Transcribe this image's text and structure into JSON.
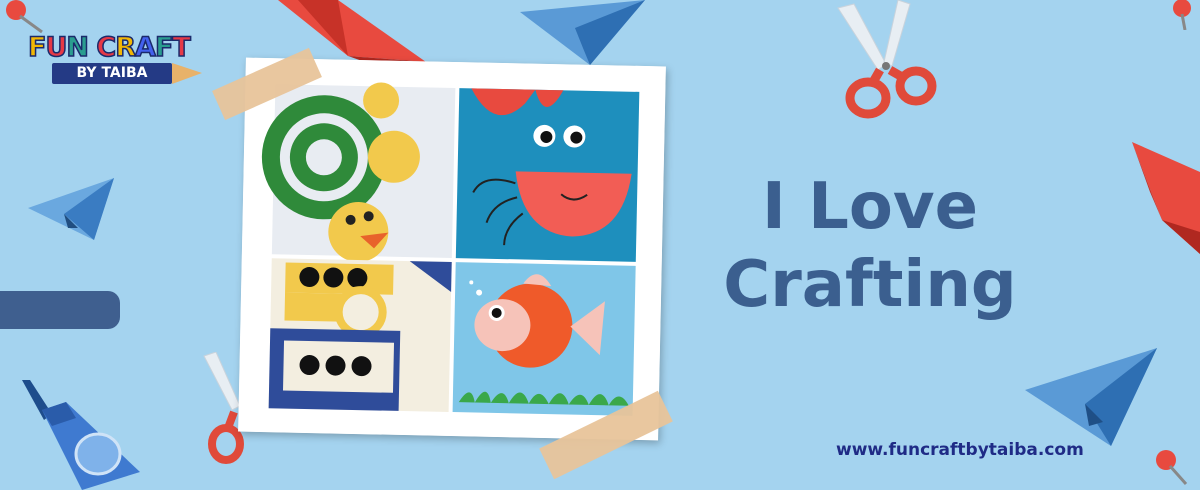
{
  "logo": {
    "line1": [
      "F",
      "U",
      "N",
      " ",
      "C",
      "R",
      "A",
      "F",
      "T"
    ],
    "line1_colors": [
      "#f2b705",
      "#e63946",
      "#2a9d8f",
      "#ffffff",
      "#e63946",
      "#f2b705",
      "#4361ee",
      "#2a9d8f",
      "#e63946"
    ],
    "line2": "BY TAIBA"
  },
  "headline": {
    "line1": "I Love",
    "line2": "Crafting"
  },
  "website": "www.funcraftbytaiba.com",
  "colors": {
    "background": "#a4d3ef",
    "headline": "#3b5f8f",
    "url": "#1f2b86",
    "accent_red": "#e84a3f",
    "accent_blue": "#4a86c8"
  },
  "icons": [
    "paper-plane-icon",
    "origami-boat-icon",
    "scissors-icon",
    "push-pin-icon",
    "glue-bottle-icon"
  ]
}
